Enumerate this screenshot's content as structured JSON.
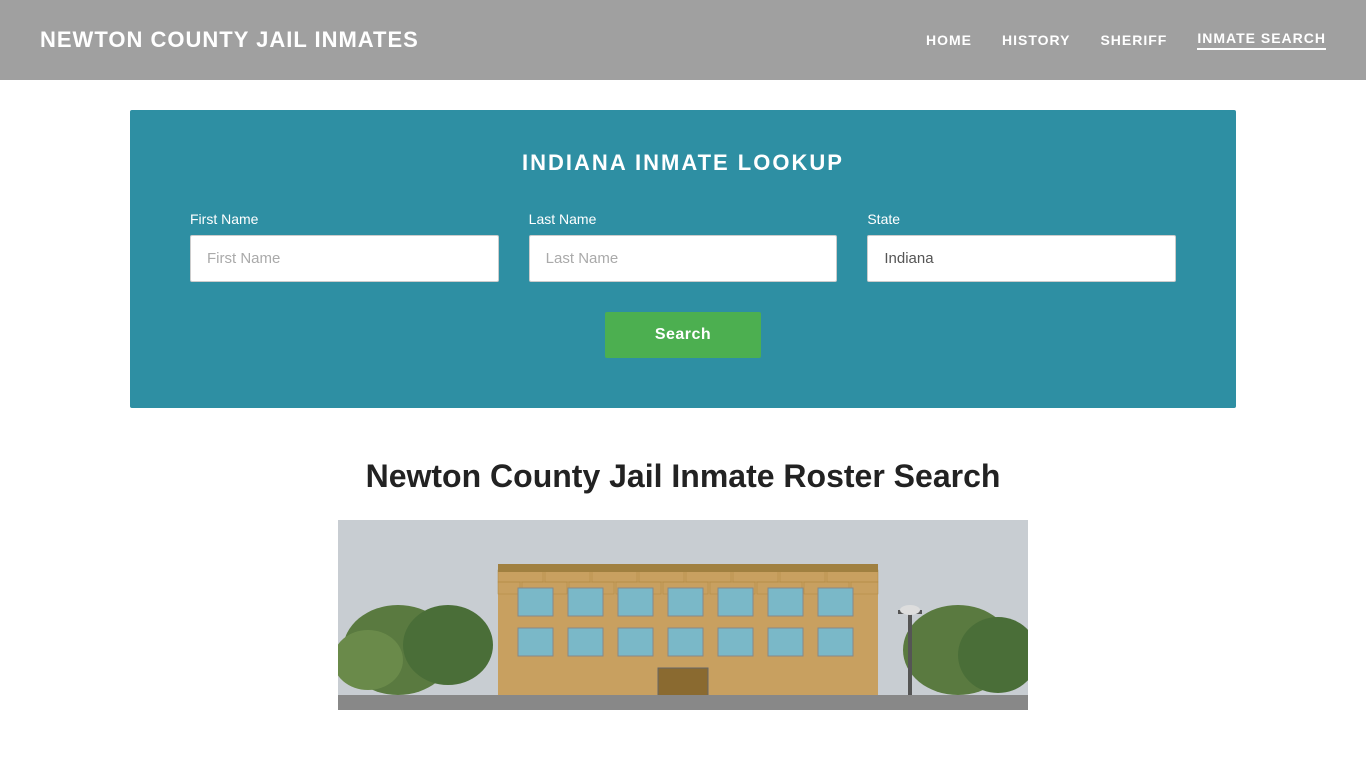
{
  "header": {
    "site_title": "NEWTON COUNTY JAIL INMATES",
    "nav": [
      {
        "label": "HOME",
        "active": false
      },
      {
        "label": "HISTORY",
        "active": false
      },
      {
        "label": "SHERIFF",
        "active": false
      },
      {
        "label": "INMATE SEARCH",
        "active": true
      }
    ]
  },
  "lookup": {
    "title": "INDIANA INMATE LOOKUP",
    "fields": {
      "first_name": {
        "label": "First Name",
        "placeholder": "First Name"
      },
      "last_name": {
        "label": "Last Name",
        "placeholder": "Last Name"
      },
      "state": {
        "label": "State",
        "value": "Indiana"
      }
    },
    "search_button": "Search"
  },
  "content": {
    "section_title": "Newton County Jail Inmate Roster Search"
  }
}
